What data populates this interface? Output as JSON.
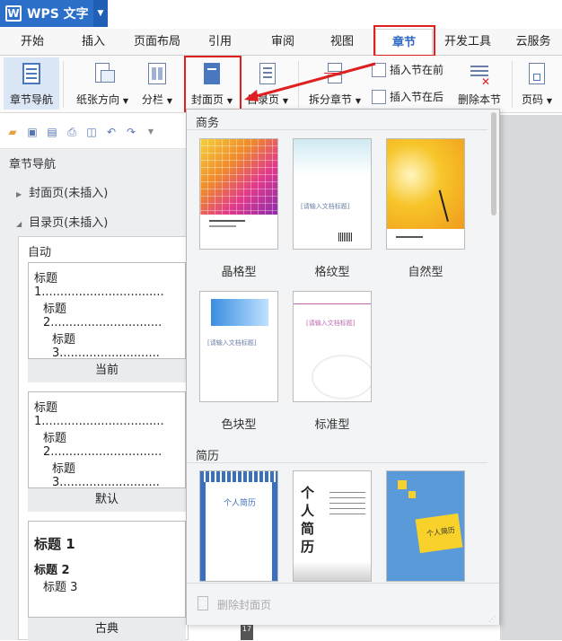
{
  "app": {
    "title": "WPS 文字"
  },
  "tabs": [
    "开始",
    "插入",
    "页面布局",
    "引用",
    "审阅",
    "视图",
    "章节",
    "开发工具",
    "云服务"
  ],
  "active_tab": "章节",
  "ribbon": {
    "nav": "章节导航",
    "orientation": "纸张方向",
    "columns": "分栏",
    "cover": "封面页",
    "toc": "目录页",
    "split": "拆分章节",
    "insert_before": "插入节在前",
    "insert_after": "插入节在后",
    "delete_section": "删除本节",
    "page_number": "页码"
  },
  "nav_pane": {
    "title": "章节导航",
    "nodes": [
      "封面页(未插入)",
      "目录页(未插入)"
    ],
    "toc_groups": [
      {
        "label": "自动",
        "lines": [
          "标题 1.................................",
          "标题 2..............................",
          "标题 3..........................."
        ],
        "footer": "当前"
      },
      {
        "label": "",
        "lines": [
          "标题 1.................................",
          "标题 2..............................",
          "标题 3..........................."
        ],
        "footer": "默认"
      },
      {
        "label": "",
        "lines": [
          "标题 1",
          "标题 2",
          "标题 3"
        ],
        "footer": "古典"
      }
    ]
  },
  "dropdown": {
    "section_business": "商务",
    "section_resume": "简历",
    "business_items": [
      "晶格型",
      "格纹型",
      "自然型",
      "色块型",
      "标准型"
    ],
    "cover_placeholder": "[请输入文档标题]",
    "resume_text": "个人简历",
    "delete_label": "删除封面页"
  },
  "colors": {
    "accent": "#2b6fc9",
    "highlight": "#e02020",
    "active_tab_text": "#2f6ac5"
  },
  "ruler_number": "17"
}
